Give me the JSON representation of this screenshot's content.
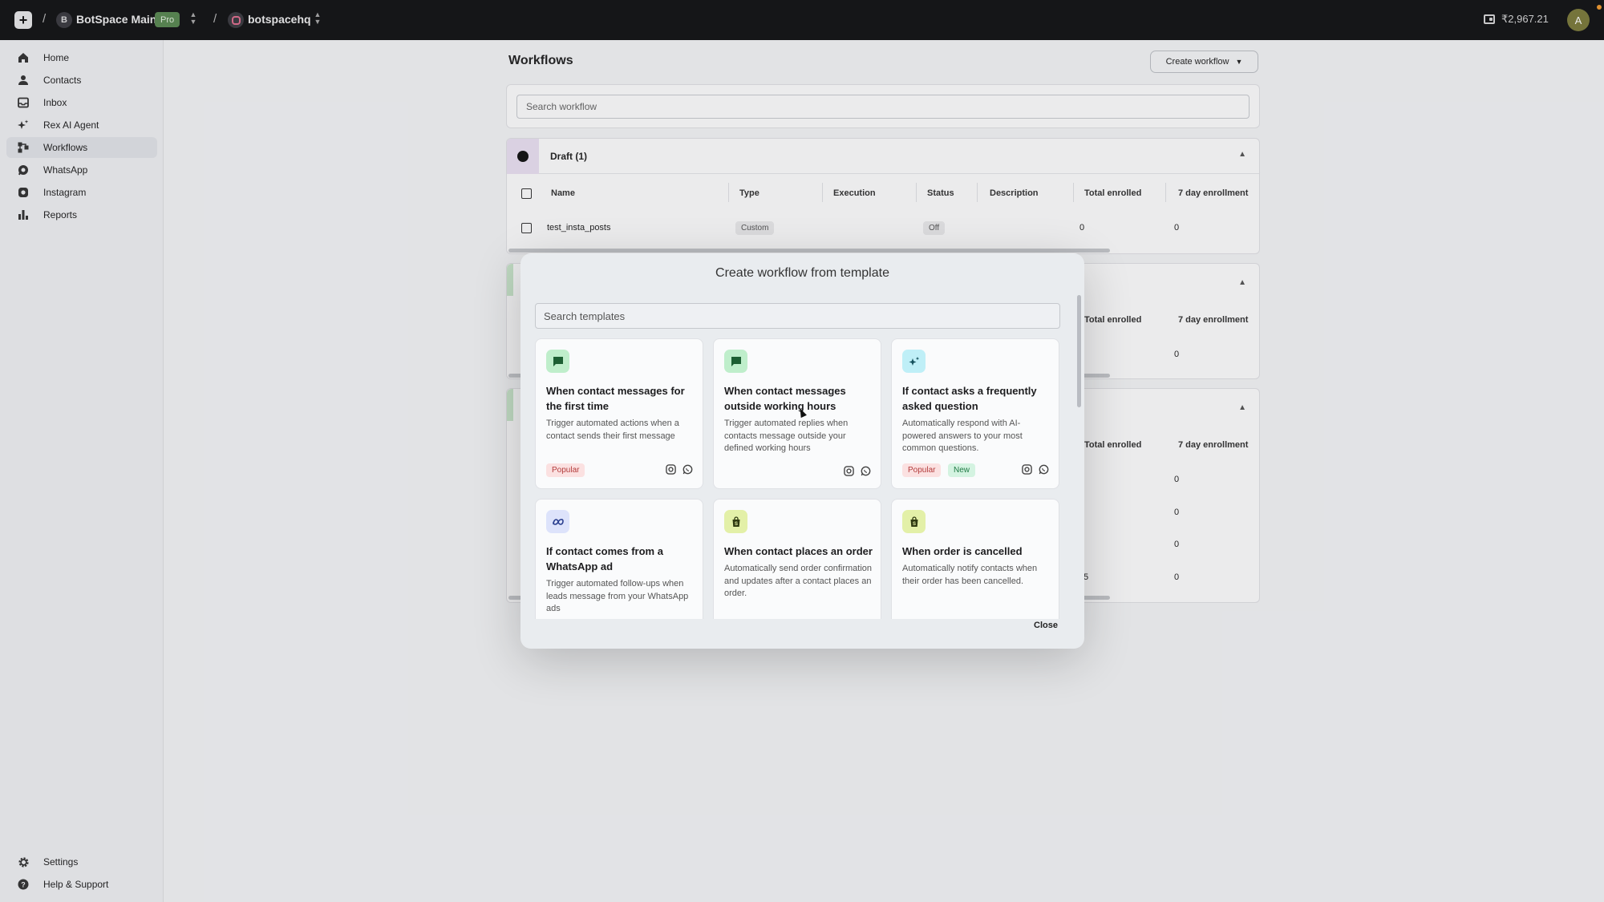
{
  "topbar": {
    "separator": "/",
    "workspace_initial": "B",
    "workspace_name": "BotSpace Main",
    "plan_badge": "Pro",
    "account_name": "botspacehq",
    "wallet_balance": "₹2,967.21",
    "user_initial": "A"
  },
  "sidebar": {
    "items": [
      {
        "label": "Home",
        "icon": "home-icon"
      },
      {
        "label": "Contacts",
        "icon": "user-icon"
      },
      {
        "label": "Inbox",
        "icon": "inbox-icon"
      },
      {
        "label": "Rex AI Agent",
        "icon": "sparkle-icon"
      },
      {
        "label": "Workflows",
        "icon": "workflow-icon",
        "active": true
      },
      {
        "label": "WhatsApp",
        "icon": "whatsapp-icon"
      },
      {
        "label": "Instagram",
        "icon": "instagram-icon"
      },
      {
        "label": "Reports",
        "icon": "bar-chart-icon"
      }
    ],
    "bottom_items": [
      {
        "label": "Settings",
        "icon": "gear-icon"
      },
      {
        "label": "Help & Support",
        "icon": "help-icon"
      }
    ]
  },
  "main": {
    "title": "Workflows",
    "create_button": "Create workflow",
    "search_placeholder": "Search workflow",
    "draft_section": {
      "title": "Draft (1)",
      "columns": [
        "Name",
        "Type",
        "Execution",
        "Status",
        "Description",
        "Total enrolled",
        "7 day enrollment"
      ],
      "rows": [
        {
          "name": "test_insta_posts",
          "type": "Custom",
          "execution": "",
          "status": "Off",
          "description": "",
          "total_enrolled": "0",
          "seven_day": "0"
        }
      ]
    },
    "section2": {
      "columns": [
        "Total enrolled",
        "7 day enrollment"
      ],
      "values": [
        "0"
      ]
    },
    "section3": {
      "columns": [
        "Total enrolled",
        "7 day enrollment"
      ],
      "values": [
        "0",
        "0",
        "0",
        "0"
      ],
      "partial_total": "5"
    }
  },
  "modal": {
    "title": "Create workflow from template",
    "search_placeholder": "Search templates",
    "close_label": "Close",
    "templates": [
      {
        "title": "When contact messages for the first time",
        "description": "Trigger automated actions when a contact sends their first message",
        "tags": [
          "Popular"
        ],
        "icon": "chat-icon",
        "icon_bg": "#bfeecb",
        "channels": [
          "instagram-icon",
          "whatsapp-icon"
        ]
      },
      {
        "title": "When contact messages outside working hours",
        "description": "Trigger automated replies when contacts message outside your defined working hours",
        "tags": [],
        "icon": "chat-icon",
        "icon_bg": "#bfeecb",
        "channels": [
          "instagram-icon",
          "whatsapp-icon"
        ]
      },
      {
        "title": "If contact asks a frequently asked question",
        "description": "Automatically respond with AI-powered answers to your most common questions.",
        "tags": [
          "Popular",
          "New"
        ],
        "icon": "sparkle-icon",
        "icon_bg": "#bfeff7",
        "channels": [
          "instagram-icon",
          "whatsapp-icon"
        ]
      },
      {
        "title": "If contact comes from a WhatsApp ad",
        "description": "Trigger automated follow-ups when leads message from your WhatsApp ads",
        "tags": [],
        "icon": "meta-icon",
        "icon_bg": "#dde3fb",
        "channels": []
      },
      {
        "title": "When contact places an order",
        "description": "Automatically send order confirmation and updates after a contact places an order.",
        "tags": [],
        "icon": "shopify-bag-icon",
        "icon_bg": "#e3f0a8",
        "channels": []
      },
      {
        "title": "When order is cancelled",
        "description": "Automatically notify contacts when their order has been cancelled.",
        "tags": [],
        "icon": "shopify-bag-icon",
        "icon_bg": "#e3f0a8",
        "channels": []
      }
    ]
  }
}
